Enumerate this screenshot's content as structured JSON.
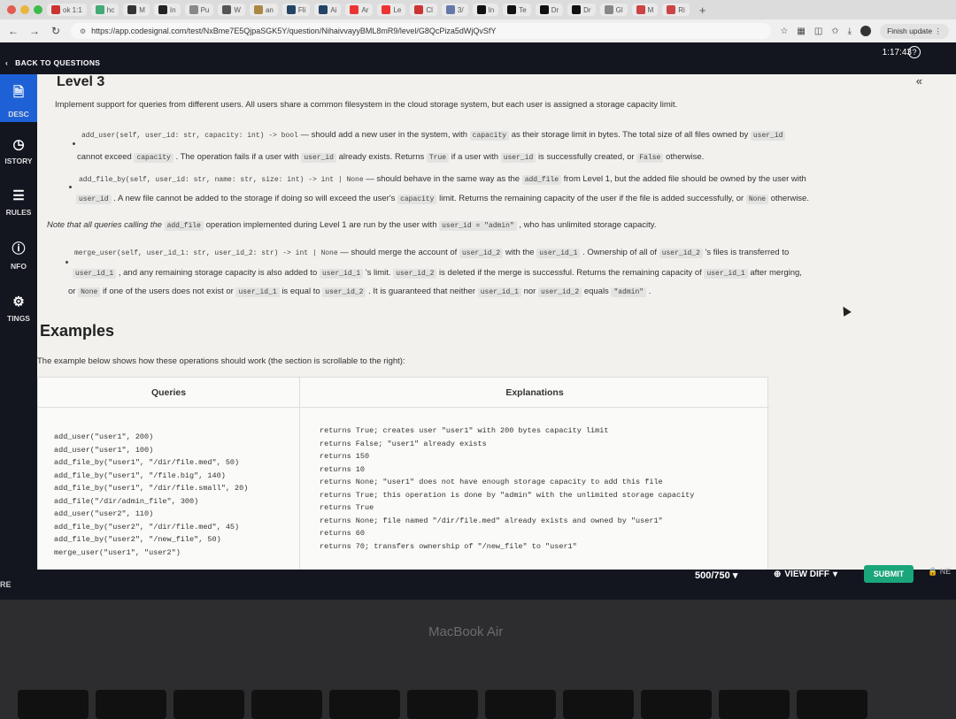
{
  "browser": {
    "tabs": [
      "ok 1:1",
      "hc",
      "M",
      "In",
      "Pu",
      "W",
      "an",
      "Fli",
      "Ai",
      "Ar",
      "Le",
      "Cl",
      "3/",
      "In",
      "Te",
      "Dr",
      "Dr",
      "Gl",
      "M",
      "Ri"
    ],
    "url": "https://app.codesignal.com/test/NxBme7E5QjpaSGK5Y/question/NihaivvayyBML8mR9/level/G8QcPiza5dWjQvSfY",
    "finish_update": "Finish update"
  },
  "app": {
    "back_label": "BACK TO QUESTIONS",
    "timer": "1:17:43",
    "sidebar": [
      {
        "label": "DESC",
        "icon": "document-icon"
      },
      {
        "label": "ISTORY",
        "icon": "clock-icon"
      },
      {
        "label": "RULES",
        "icon": "list-icon"
      },
      {
        "label": "NFO",
        "icon": "info-icon"
      },
      {
        "label": "TINGS",
        "icon": "gear-icon"
      }
    ]
  },
  "desc": {
    "level": "Level 3",
    "intro": "Implement support for queries from different users. All users share a common filesystem in the cloud storage system, but each user is assigned a storage capacity limit.",
    "add_user": {
      "sig": "add_user(self, user_id: str, capacity: int) -> bool",
      "l1a": "— should add a new user in the system, with",
      "c1": "capacity",
      "l1b": "as their storage limit in bytes. The total size of all files owned by",
      "c2": "user_id",
      "l2a": "cannot exceed",
      "c3": "capacity",
      "l2b": ". The operation fails if a user with",
      "c4": "user_id",
      "l2c": "already exists. Returns",
      "c5": "True",
      "l2d": "if a user with",
      "c6": "user_id",
      "l2e": "is successfully created, or",
      "c7": "False",
      "l2f": "otherwise."
    },
    "add_file_by": {
      "sig": "add_file_by(self, user_id: str, name: str, size: int) -> int | None",
      "l1a": "— should behave in the same way as the",
      "c1": "add_file",
      "l1b": "from Level 1, but the added file should be owned by the user with",
      "c2": "user_id",
      "l2a": ". A new file cannot be added to the storage if doing so will exceed the user's",
      "c3": "capacity",
      "l2b": "limit. Returns the remaining capacity of the user if the file is added successfully, or",
      "c4": "None",
      "l2c": "otherwise."
    },
    "note": {
      "a": "Note that all queries calling the",
      "c1": "add_file",
      "b": "operation implemented during Level 1 are run by the user with",
      "c2": "user_id = \"admin\"",
      "d": ", who has unlimited storage capacity."
    },
    "merge_user": {
      "sig": "merge_user(self, user_id_1: str, user_id_2: str) -> int | None",
      "l1a": "— should merge the account of",
      "c1": "user_id_2",
      "l1b": "with the",
      "c2": "user_id_1",
      "l1c": ". Ownership of all of",
      "c3": "user_id_2",
      "l1d": "'s files is transferred to",
      "c4": "user_id_1",
      "l2a": ", and any remaining storage capacity is also added to",
      "c5": "user_id_1",
      "l2b": "'s limit.",
      "c6": "user_id_2",
      "l2c": "is deleted if the merge is successful. Returns the remaining capacity of",
      "c7": "user_id_1",
      "l2d": "after merging,",
      "l3a": "or",
      "c8": "None",
      "l3b": "if one of the users does not exist or",
      "c9": "user_id_1",
      "l3c": "is equal to",
      "c10": "user_id_2",
      "l3d": ". It is guaranteed that neither",
      "c11": "user_id_1",
      "l3e": "nor",
      "c12": "user_id_2",
      "l3f": "equals",
      "c13": "\"admin\"",
      "l3g": "."
    },
    "examples_title": "Examples",
    "examples_intro": "The example below shows how these operations should work (the section is scrollable to the right):",
    "table": {
      "headers": [
        "Queries",
        "Explanations"
      ],
      "queries": [
        "add_user(\"user1\", 200)",
        "add_user(\"user1\", 100)",
        "add_file_by(\"user1\", \"/dir/file.med\", 50)",
        "add_file_by(\"user1\", \"/file.big\", 140)",
        "add_file_by(\"user1\", \"/dir/file.small\", 20)",
        "add_file(\"/dir/admin_file\", 300)",
        "add_user(\"user2\", 110)",
        "add_file_by(\"user2\", \"/dir/file.med\", 45)",
        "add_file_by(\"user2\", \"/new_file\", 50)",
        "merge_user(\"user1\", \"user2\")"
      ],
      "explanations": [
        "returns True; creates user \"user1\" with 200 bytes capacity limit",
        "returns False; \"user1\" already exists",
        "returns 150",
        "returns 10",
        "returns None; \"user1\" does not have enough storage capacity to add this file",
        "returns True; this operation is done by \"admin\" with the unlimited storage capacity",
        "returns True",
        "returns None; file named \"/dir/file.med\" already exists and owned by \"user1\"",
        "returns 60",
        "returns 70; transfers ownership of \"/new_file\" to \"user1\""
      ]
    }
  },
  "footer": {
    "left": "RE",
    "count": "500/750",
    "view_diff": "VIEW DIFF",
    "submit": "SUBMIT",
    "next": "NE"
  },
  "device": {
    "label": "MacBook Air"
  }
}
